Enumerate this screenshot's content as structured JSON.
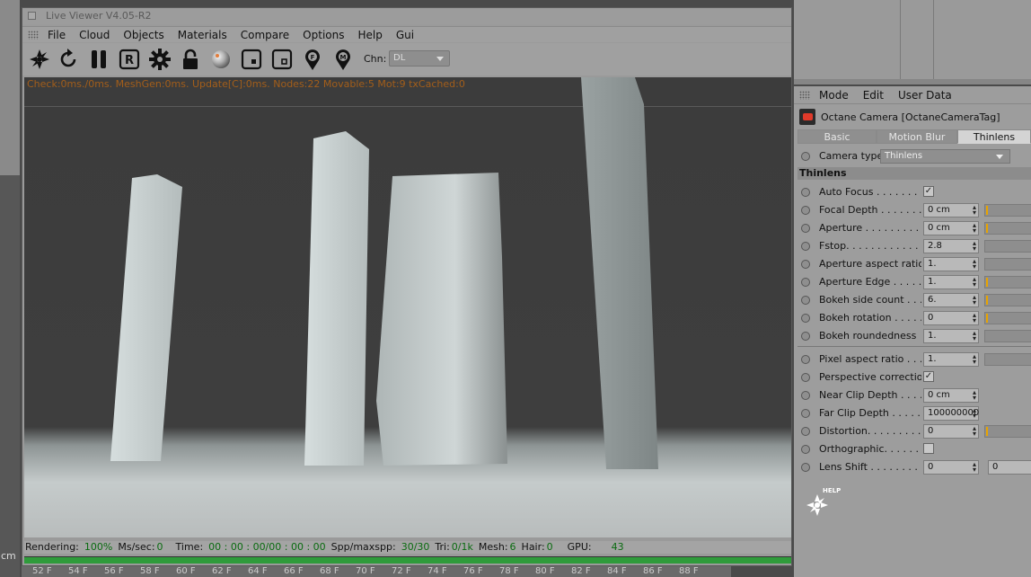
{
  "window": {
    "title": "Live Viewer V4.05-R2"
  },
  "menu": [
    "File",
    "Cloud",
    "Objects",
    "Materials",
    "Compare",
    "Options",
    "Help",
    "Gui"
  ],
  "toolbar": {
    "icons": [
      "octane-logo-icon",
      "refresh-icon",
      "pause-icon",
      "r-icon",
      "gear-icon",
      "lock-icon",
      "sphere-icon",
      "region-icon",
      "region-film-icon",
      "pin-f-icon",
      "pin-m-icon"
    ],
    "r_label": "R",
    "f_label": "F",
    "m_label": "M",
    "chn_label": "Chn:",
    "chn_value": "DL"
  },
  "render_stats": "Check:0ms./0ms. MeshGen:0ms. Update[C]:0ms. Nodes:22 Movable:5 Mot:9 txCached:0",
  "status": {
    "rendering_label": "Rendering:",
    "rendering_value": "100%",
    "mssec_label": "Ms/sec:",
    "mssec_value": "0",
    "time_label": "Time:",
    "time_value": "00 : 00 : 00/00 : 00 : 00",
    "spp_label": "Spp/maxspp:",
    "spp_value": "30/30",
    "tri_label": "Tri:",
    "tri_value": "0/1k",
    "mesh_label": "Mesh:",
    "mesh_value": "6",
    "hair_label": "Hair:",
    "hair_value": "0",
    "gpu_label": "GPU:",
    "gpu_value": "43"
  },
  "render_progress": 1.0,
  "left_unit": "cm",
  "timeline": [
    "52 F",
    "54 F",
    "56 F",
    "58 F",
    "60 F",
    "62 F",
    "64 F",
    "66 F",
    "68 F",
    "70 F",
    "72 F",
    "74 F",
    "76 F",
    "78 F",
    "80 F",
    "82 F",
    "84 F",
    "86 F",
    "88 F"
  ],
  "attr_menu": [
    "Mode",
    "Edit",
    "User Data"
  ],
  "object_title": "Octane Camera [OctaneCameraTag]",
  "tabs": [
    {
      "label": "Basic",
      "active": false
    },
    {
      "label": "Motion Blur",
      "active": false
    },
    {
      "label": "Thinlens",
      "active": true
    }
  ],
  "camera_type": {
    "label": "Camera type",
    "value": "Thinlens"
  },
  "section": "Thinlens",
  "params": [
    {
      "label": "Auto Focus . . . . . . . . .",
      "type": "check",
      "checked": true
    },
    {
      "label": "Focal Depth . . . . . . . . .",
      "type": "num",
      "value": "0 cm",
      "slider": true,
      "mark": true
    },
    {
      "label": "Aperture . . . . . . . . . . .",
      "type": "num",
      "value": "0 cm",
      "slider": true,
      "mark": true
    },
    {
      "label": "Fstop. . . . . . . . . . . . . . .",
      "type": "num",
      "value": "2.8",
      "slider": true,
      "mark": false
    },
    {
      "label": "Aperture aspect ratio",
      "type": "num",
      "value": "1.",
      "slider": true,
      "mark": false
    },
    {
      "label": "Aperture Edge . . . . . .",
      "type": "num",
      "value": "1.",
      "slider": true,
      "mark": true
    },
    {
      "label": "Bokeh side count . . . .",
      "type": "num",
      "value": "6.",
      "slider": true,
      "mark": true
    },
    {
      "label": "Bokeh rotation . . . . . .",
      "type": "num",
      "value": "0",
      "slider": true,
      "mark": true
    },
    {
      "label": "Bokeh roundedness",
      "type": "num",
      "value": "1.",
      "slider": true,
      "mark": false
    }
  ],
  "params2": [
    {
      "label": "Pixel aspect ratio . . . .",
      "type": "num",
      "value": "1.",
      "slider": true,
      "mark": false
    },
    {
      "label": "Perspective correction",
      "type": "check",
      "checked": true
    },
    {
      "label": "Near Clip Depth . . . . .",
      "type": "num",
      "value": "0 cm",
      "slider": false
    },
    {
      "label": "Far Clip Depth . . . . . . .",
      "type": "num",
      "value": "100000000",
      "slider": false
    },
    {
      "label": "Distortion. . . . . . . . . . .",
      "type": "num",
      "value": "0",
      "slider": true,
      "mark": true
    },
    {
      "label": "Orthographic. . . . . . . .",
      "type": "check",
      "checked": false
    },
    {
      "label": "Lens Shift . . . . . . . . . .",
      "type": "num2",
      "value": "0",
      "value2": "0"
    }
  ],
  "help_label": "HELP"
}
